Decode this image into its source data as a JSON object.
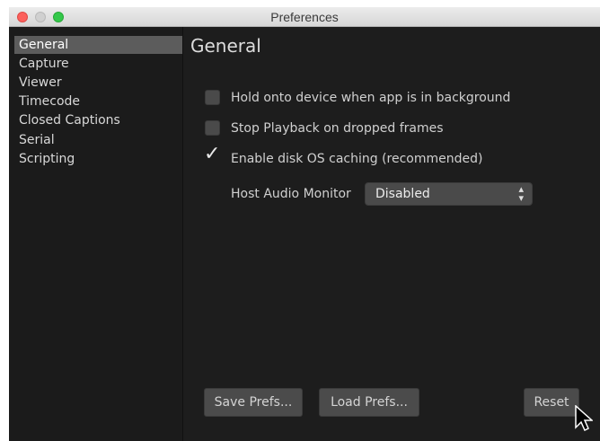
{
  "window": {
    "title": "Preferences"
  },
  "sidebar": {
    "items": [
      {
        "label": "General",
        "selected": true
      },
      {
        "label": "Capture",
        "selected": false
      },
      {
        "label": "Viewer",
        "selected": false
      },
      {
        "label": "Timecode",
        "selected": false
      },
      {
        "label": "Closed Captions",
        "selected": false
      },
      {
        "label": "Serial",
        "selected": false
      },
      {
        "label": "Scripting",
        "selected": false
      }
    ]
  },
  "main": {
    "section_title": "General",
    "options": [
      {
        "label": "Hold onto device when app is in background",
        "checked": false
      },
      {
        "label": "Stop Playback on dropped frames",
        "checked": false
      },
      {
        "label": "Enable disk OS caching (recommended)",
        "checked": true
      }
    ],
    "host_audio": {
      "label": "Host Audio Monitor",
      "value": "Disabled"
    }
  },
  "buttons": {
    "save": "Save Prefs...",
    "load": "Load Prefs...",
    "reset": "Reset"
  },
  "colors": {
    "background": "#1d1d1d",
    "sidebar_selected": "#5c5c5c",
    "control": "#4a4a4a"
  }
}
